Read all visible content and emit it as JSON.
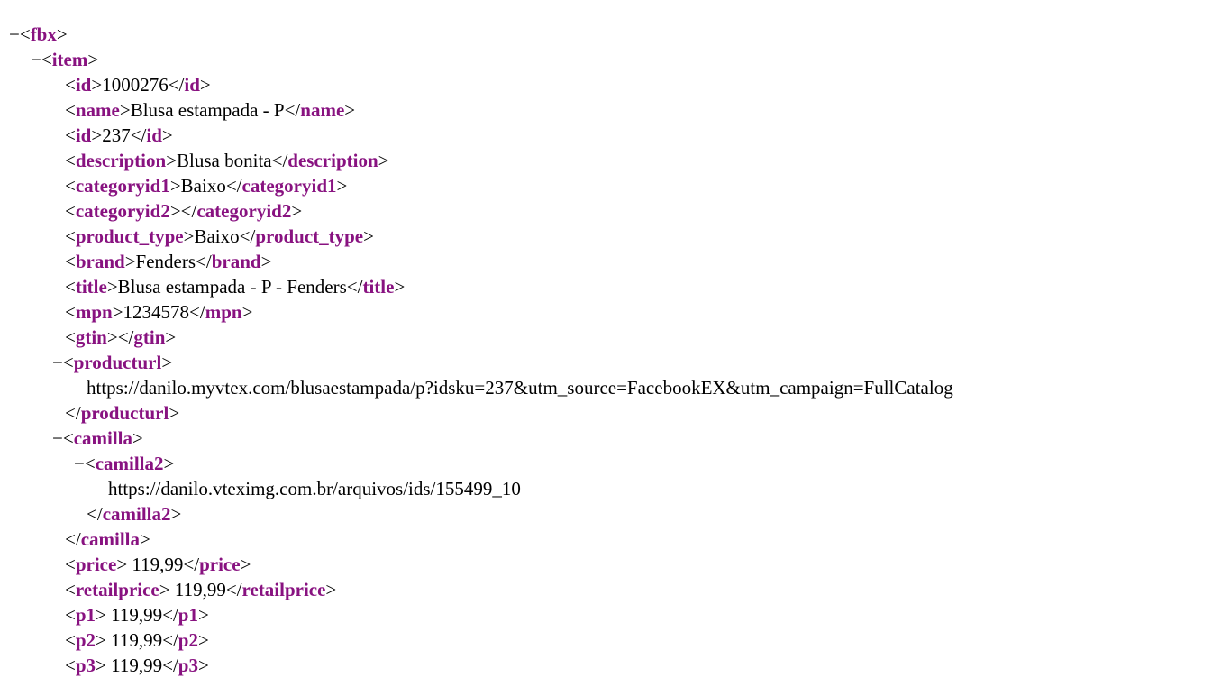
{
  "root_tag": "fbx",
  "item_tag": "item",
  "collapse_glyph": "−",
  "elements": [
    {
      "tag": "id",
      "text": "1000276"
    },
    {
      "tag": "name",
      "text": "Blusa estampada - P"
    },
    {
      "tag": "id",
      "text": "237"
    },
    {
      "tag": "description",
      "text": "Blusa bonita"
    },
    {
      "tag": "categoryid1",
      "text": "Baixo"
    },
    {
      "tag": "categoryid2",
      "text": ""
    },
    {
      "tag": "product_type",
      "text": "Baixo"
    },
    {
      "tag": "brand",
      "text": "Fenders"
    },
    {
      "tag": "title",
      "text": "Blusa estampada - P - Fenders"
    },
    {
      "tag": "mpn",
      "text": "1234578"
    },
    {
      "tag": "gtin",
      "text": ""
    }
  ],
  "producturl": {
    "tag": "producturl",
    "text": "https://danilo.myvtex.com/blusaestampada/p?idsku=237&utm_source=FacebookEX&utm_campaign=FullCatalog"
  },
  "camilla": {
    "tag": "camilla",
    "child_tag": "camilla2",
    "child_text": "https://danilo.vteximg.com.br/arquivos/ids/155499_10"
  },
  "prices": [
    {
      "tag": "price",
      "text": " 119,99"
    },
    {
      "tag": "retailprice",
      "text": " 119,99"
    },
    {
      "tag": "p1",
      "text": " 119,99"
    },
    {
      "tag": "p2",
      "text": " 119,99"
    },
    {
      "tag": "p3",
      "text": " 119,99"
    }
  ],
  "colors": {
    "tag": "#881280",
    "text": "#000000",
    "background": "#ffffff"
  }
}
